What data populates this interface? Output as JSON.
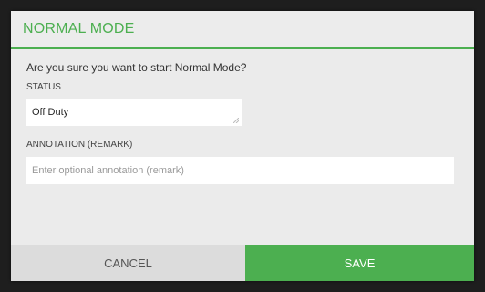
{
  "dialog": {
    "title": "NORMAL MODE",
    "question": "Are you sure you want to start Normal Mode?",
    "status_label": "STATUS",
    "status_value": "Off Duty",
    "annotation_label": "ANNOTATION (REMARK)",
    "annotation_placeholder": "Enter optional annotation (remark)",
    "annotation_value": "",
    "cancel_label": "CANCEL",
    "save_label": "SAVE"
  },
  "colors": {
    "accent": "#4caf50",
    "dialog_bg": "#ebebeb",
    "cancel_bg": "#dcdcdc"
  }
}
